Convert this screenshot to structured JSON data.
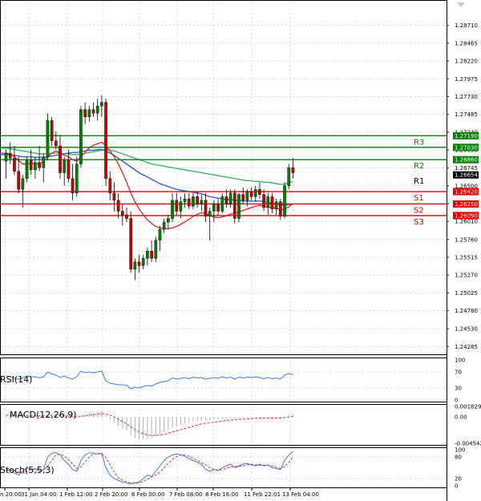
{
  "chart_data": {
    "type": "candlestick",
    "price_axis": {
      "ylim": [
        1.242,
        1.2895
      ],
      "ticks": [
        "1.28710",
        "1.28465",
        "1.28220",
        "1.27975",
        "1.27730",
        "1.27485",
        "1.27240",
        "1.26995",
        "1.26745",
        "1.26500",
        "1.26255",
        "1.26010",
        "1.25760",
        "1.25515",
        "1.25270",
        "1.25025",
        "1.24780",
        "1.24530",
        "1.24285"
      ]
    },
    "time_axis": {
      "labels": [
        "n 20:00",
        "31 Jan 04:00",
        "1 Feb 12:00",
        "2 Feb 20:00",
        "6 Feb 00:00",
        "7 Feb 08:00",
        "8 Feb 16:00",
        "11 Feb 22:01",
        "13 Feb 04:00"
      ]
    },
    "candles": [
      {
        "o": 1.2684,
        "h": 1.27,
        "l": 1.266,
        "c": 1.2695
      },
      {
        "o": 1.2695,
        "h": 1.271,
        "l": 1.268,
        "c": 1.2688
      },
      {
        "o": 1.2688,
        "h": 1.2705,
        "l": 1.2665,
        "c": 1.267
      },
      {
        "o": 1.267,
        "h": 1.269,
        "l": 1.264,
        "c": 1.2645
      },
      {
        "o": 1.2645,
        "h": 1.2665,
        "l": 1.262,
        "c": 1.266
      },
      {
        "o": 1.266,
        "h": 1.269,
        "l": 1.2655,
        "c": 1.2685
      },
      {
        "o": 1.2685,
        "h": 1.27,
        "l": 1.2665,
        "c": 1.2672
      },
      {
        "o": 1.2672,
        "h": 1.269,
        "l": 1.266,
        "c": 1.2682
      },
      {
        "o": 1.2682,
        "h": 1.2705,
        "l": 1.267,
        "c": 1.2675
      },
      {
        "o": 1.2675,
        "h": 1.2695,
        "l": 1.2655,
        "c": 1.269
      },
      {
        "o": 1.269,
        "h": 1.275,
        "l": 1.2685,
        "c": 1.274
      },
      {
        "o": 1.274,
        "h": 1.2745,
        "l": 1.2705,
        "c": 1.2712
      },
      {
        "o": 1.2712,
        "h": 1.2725,
        "l": 1.27,
        "c": 1.2705
      },
      {
        "o": 1.2705,
        "h": 1.272,
        "l": 1.266,
        "c": 1.2668
      },
      {
        "o": 1.2668,
        "h": 1.269,
        "l": 1.265,
        "c": 1.2685
      },
      {
        "o": 1.2685,
        "h": 1.27,
        "l": 1.2655,
        "c": 1.266
      },
      {
        "o": 1.266,
        "h": 1.268,
        "l": 1.263,
        "c": 1.264
      },
      {
        "o": 1.264,
        "h": 1.269,
        "l": 1.2635,
        "c": 1.268
      },
      {
        "o": 1.268,
        "h": 1.276,
        "l": 1.2675,
        "c": 1.2755
      },
      {
        "o": 1.2755,
        "h": 1.2765,
        "l": 1.2735,
        "c": 1.2745
      },
      {
        "o": 1.2745,
        "h": 1.276,
        "l": 1.2738,
        "c": 1.2755
      },
      {
        "o": 1.2755,
        "h": 1.2765,
        "l": 1.2745,
        "c": 1.275
      },
      {
        "o": 1.275,
        "h": 1.277,
        "l": 1.274,
        "c": 1.276
      },
      {
        "o": 1.276,
        "h": 1.2775,
        "l": 1.2745,
        "c": 1.2765
      },
      {
        "o": 1.2765,
        "h": 1.277,
        "l": 1.265,
        "c": 1.266
      },
      {
        "o": 1.266,
        "h": 1.267,
        "l": 1.263,
        "c": 1.264
      },
      {
        "o": 1.264,
        "h": 1.2655,
        "l": 1.2615,
        "c": 1.263
      },
      {
        "o": 1.263,
        "h": 1.264,
        "l": 1.2605,
        "c": 1.2615
      },
      {
        "o": 1.2615,
        "h": 1.2625,
        "l": 1.2595,
        "c": 1.261
      },
      {
        "o": 1.261,
        "h": 1.262,
        "l": 1.26,
        "c": 1.2605
      },
      {
        "o": 1.2605,
        "h": 1.2615,
        "l": 1.253,
        "c": 1.2535
      },
      {
        "o": 1.2535,
        "h": 1.255,
        "l": 1.252,
        "c": 1.2545
      },
      {
        "o": 1.2545,
        "h": 1.2555,
        "l": 1.253,
        "c": 1.254
      },
      {
        "o": 1.254,
        "h": 1.2555,
        "l": 1.2535,
        "c": 1.255
      },
      {
        "o": 1.255,
        "h": 1.2565,
        "l": 1.254,
        "c": 1.256
      },
      {
        "o": 1.256,
        "h": 1.2575,
        "l": 1.2545,
        "c": 1.255
      },
      {
        "o": 1.255,
        "h": 1.258,
        "l": 1.2545,
        "c": 1.2575
      },
      {
        "o": 1.2575,
        "h": 1.2595,
        "l": 1.256,
        "c": 1.259
      },
      {
        "o": 1.259,
        "h": 1.2605,
        "l": 1.2585,
        "c": 1.26
      },
      {
        "o": 1.26,
        "h": 1.261,
        "l": 1.259,
        "c": 1.2605
      },
      {
        "o": 1.2605,
        "h": 1.264,
        "l": 1.26,
        "c": 1.263
      },
      {
        "o": 1.263,
        "h": 1.264,
        "l": 1.261,
        "c": 1.2615
      },
      {
        "o": 1.2615,
        "h": 1.2635,
        "l": 1.2605,
        "c": 1.2628
      },
      {
        "o": 1.2628,
        "h": 1.264,
        "l": 1.262,
        "c": 1.2632
      },
      {
        "o": 1.2632,
        "h": 1.264,
        "l": 1.2618,
        "c": 1.2622
      },
      {
        "o": 1.2622,
        "h": 1.264,
        "l": 1.2618,
        "c": 1.2635
      },
      {
        "o": 1.2635,
        "h": 1.2642,
        "l": 1.262,
        "c": 1.2625
      },
      {
        "o": 1.2625,
        "h": 1.2638,
        "l": 1.2615,
        "c": 1.263
      },
      {
        "o": 1.263,
        "h": 1.264,
        "l": 1.26,
        "c": 1.2608
      },
      {
        "o": 1.2608,
        "h": 1.262,
        "l": 1.2575,
        "c": 1.2615
      },
      {
        "o": 1.2615,
        "h": 1.263,
        "l": 1.26,
        "c": 1.2625
      },
      {
        "o": 1.2625,
        "h": 1.2632,
        "l": 1.261,
        "c": 1.2615
      },
      {
        "o": 1.2615,
        "h": 1.264,
        "l": 1.2612,
        "c": 1.2635
      },
      {
        "o": 1.2635,
        "h": 1.2645,
        "l": 1.262,
        "c": 1.2625
      },
      {
        "o": 1.2625,
        "h": 1.2645,
        "l": 1.262,
        "c": 1.264
      },
      {
        "o": 1.264,
        "h": 1.2645,
        "l": 1.2598,
        "c": 1.2605
      },
      {
        "o": 1.2605,
        "h": 1.264,
        "l": 1.26,
        "c": 1.2638
      },
      {
        "o": 1.2638,
        "h": 1.2648,
        "l": 1.2625,
        "c": 1.263
      },
      {
        "o": 1.263,
        "h": 1.2645,
        "l": 1.2622,
        "c": 1.2642
      },
      {
        "o": 1.2642,
        "h": 1.2648,
        "l": 1.263,
        "c": 1.2635
      },
      {
        "o": 1.2635,
        "h": 1.265,
        "l": 1.2628,
        "c": 1.2645
      },
      {
        "o": 1.2645,
        "h": 1.2655,
        "l": 1.2632,
        "c": 1.2638
      },
      {
        "o": 1.2638,
        "h": 1.2645,
        "l": 1.2615,
        "c": 1.262
      },
      {
        "o": 1.262,
        "h": 1.264,
        "l": 1.261,
        "c": 1.2635
      },
      {
        "o": 1.2635,
        "h": 1.264,
        "l": 1.2612,
        "c": 1.2618
      },
      {
        "o": 1.2618,
        "h": 1.2632,
        "l": 1.261,
        "c": 1.2628
      },
      {
        "o": 1.2628,
        "h": 1.2632,
        "l": 1.2603,
        "c": 1.2608
      },
      {
        "o": 1.2608,
        "h": 1.2655,
        "l": 1.2605,
        "c": 1.265
      },
      {
        "o": 1.265,
        "h": 1.268,
        "l": 1.2645,
        "c": 1.2675
      },
      {
        "o": 1.2675,
        "h": 1.2688,
        "l": 1.266,
        "c": 1.2668
      }
    ],
    "moving_averages": [
      {
        "color": "#3cb371",
        "values": [
          1.2702,
          1.2701,
          1.27,
          1.2699,
          1.2698,
          1.2697,
          1.2696,
          1.2695,
          1.2694,
          1.2694,
          1.2694,
          1.2695,
          1.2695,
          1.2695,
          1.2694,
          1.2694,
          1.2693,
          1.2693,
          1.2694,
          1.2695,
          1.2696,
          1.2697,
          1.2698,
          1.2699,
          1.27,
          1.2699,
          1.2698,
          1.2696,
          1.2694,
          1.2692,
          1.269,
          1.2688,
          1.2686,
          1.2684,
          1.2682,
          1.268,
          1.2679,
          1.2678,
          1.2677,
          1.2676,
          1.2675,
          1.2674,
          1.2673,
          1.2672,
          1.2671,
          1.267,
          1.2669,
          1.2668,
          1.2667,
          1.2666,
          1.2665,
          1.2664,
          1.2663,
          1.2662,
          1.2661,
          1.266,
          1.2659,
          1.2658,
          1.2657,
          1.2657,
          1.2656,
          1.2656,
          1.2655,
          1.2655,
          1.2654,
          1.2653,
          1.2652,
          1.2652,
          1.2654,
          1.2656
        ]
      },
      {
        "color": "#3b5bcc",
        "values": [
          1.2693,
          1.2693,
          1.2692,
          1.2691,
          1.269,
          1.269,
          1.269,
          1.2689,
          1.2689,
          1.2689,
          1.269,
          1.2691,
          1.2692,
          1.2693,
          1.2694,
          1.2695,
          1.2696,
          1.2696,
          1.2697,
          1.2698,
          1.2699,
          1.2699,
          1.27,
          1.27,
          1.2698,
          1.2695,
          1.2692,
          1.2688,
          1.2684,
          1.268,
          1.2676,
          1.2672,
          1.2668,
          1.2665,
          1.2662,
          1.2659,
          1.2656,
          1.2653,
          1.2651,
          1.2649,
          1.2647,
          1.2645,
          1.2644,
          1.2643,
          1.2642,
          1.2641,
          1.264,
          1.2639,
          1.2637,
          1.2635,
          1.2634,
          1.2633,
          1.2632,
          1.2631,
          1.2631,
          1.263,
          1.263,
          1.2629,
          1.2629,
          1.2629,
          1.2629,
          1.2629,
          1.2628,
          1.2627,
          1.2626,
          1.2625,
          1.2624,
          1.2623,
          1.2624,
          1.2625
        ]
      },
      {
        "color": "#e03030",
        "values": [
          1.2695,
          1.2694,
          1.269,
          1.2685,
          1.268,
          1.268,
          1.2681,
          1.268,
          1.2681,
          1.2683,
          1.269,
          1.2695,
          1.2698,
          1.2695,
          1.2692,
          1.269,
          1.2686,
          1.2684,
          1.269,
          1.2696,
          1.2702,
          1.2706,
          1.2708,
          1.271,
          1.2705,
          1.2698,
          1.269,
          1.268,
          1.2668,
          1.2655,
          1.264,
          1.2628,
          1.2618,
          1.261,
          1.2603,
          1.2598,
          1.2594,
          1.2592,
          1.2591,
          1.2591,
          1.2592,
          1.2594,
          1.2597,
          1.26,
          1.2604,
          1.2608,
          1.2611,
          1.2613,
          1.2612,
          1.2609,
          1.2607,
          1.2606,
          1.2607,
          1.2609,
          1.2611,
          1.2612,
          1.2614,
          1.2616,
          1.2618,
          1.262,
          1.2622,
          1.2623,
          1.2622,
          1.2621,
          1.262,
          1.2619,
          1.2617,
          1.2618,
          1.2621,
          1.2625
        ]
      }
    ],
    "levels": [
      {
        "name": "R3",
        "value": 1.2719,
        "label": "1.27190",
        "color": "#008000"
      },
      {
        "name": "",
        "value": 1.2703,
        "label": "1.27030",
        "color": "#008000"
      },
      {
        "name": "R2",
        "value": 1.2686,
        "label": "1.26860",
        "color": "#008000"
      },
      {
        "name": "R1",
        "value": 1.2665,
        "label": "1.26654",
        "color": "#000000",
        "current": true
      },
      {
        "name": "S1",
        "value": 1.2642,
        "label": "1.26420",
        "color": "#e00000"
      },
      {
        "name": "S2",
        "value": 1.2625,
        "label": "1.26250",
        "color": "#e00000"
      },
      {
        "name": "S3",
        "value": 1.2609,
        "label": "1.26090",
        "color": "#e00000"
      }
    ],
    "rsi": {
      "label": "RSI(14)",
      "ticks": [
        "100",
        "70",
        "30",
        "0"
      ],
      "ylim": [
        0,
        100
      ],
      "values": [
        60,
        58,
        55,
        52,
        55,
        60,
        58,
        58,
        55,
        58,
        70,
        65,
        62,
        56,
        60,
        55,
        52,
        58,
        72,
        68,
        70,
        68,
        70,
        72,
        48,
        42,
        40,
        38,
        38,
        37,
        28,
        32,
        30,
        34,
        36,
        35,
        40,
        44,
        46,
        48,
        55,
        52,
        54,
        56,
        53,
        57,
        55,
        56,
        52,
        54,
        56,
        54,
        58,
        55,
        57,
        52,
        57,
        55,
        57,
        56,
        58,
        56,
        53,
        56,
        53,
        55,
        52,
        62,
        66,
        64
      ]
    },
    "macd": {
      "label": "MACD(12,26,9)",
      "ticks": [
        "0.001829",
        "0.00",
        "-0.004542"
      ],
      "ylim": [
        -0.004542,
        0.001829
      ],
      "hist": [
        0.0004,
        0.0004,
        0.0003,
        0.0002,
        0.0002,
        0.0002,
        0.0001,
        0.0001,
        0.0001,
        0.0001,
        0.0003,
        0.0004,
        0.0004,
        0.0002,
        0.0001,
        0.0,
        -0.0002,
        -0.0002,
        0.0003,
        0.0005,
        0.0007,
        0.0008,
        0.0009,
        0.001,
        0.0003,
        -0.0004,
        -0.001,
        -0.0016,
        -0.002,
        -0.0023,
        -0.0032,
        -0.0036,
        -0.0038,
        -0.0039,
        -0.0038,
        -0.0037,
        -0.0034,
        -0.003,
        -0.0026,
        -0.0022,
        -0.0018,
        -0.0016,
        -0.0013,
        -0.0011,
        -0.001,
        -0.0008,
        -0.0007,
        -0.0006,
        -0.0006,
        -0.0005,
        -0.0004,
        -0.0004,
        -0.0003,
        -0.0003,
        -0.0002,
        -0.0003,
        -0.0002,
        -0.0002,
        -0.0001,
        -0.0001,
        0.0,
        0.0,
        -0.0001,
        -0.0001,
        -0.0001,
        -0.0001,
        -0.0002,
        0.0001,
        0.0004,
        0.0005
      ],
      "signal": [
        0.0003,
        0.0003,
        0.0003,
        0.0003,
        0.0003,
        0.0003,
        0.0002,
        0.0002,
        0.0002,
        0.0002,
        0.0002,
        0.0003,
        0.0003,
        0.0003,
        0.0002,
        0.0002,
        0.0001,
        0.0,
        0.0001,
        0.0002,
        0.0003,
        0.0004,
        0.0005,
        0.0006,
        0.0005,
        0.0003,
        0.0,
        -0.0004,
        -0.0008,
        -0.0012,
        -0.0017,
        -0.0022,
        -0.0026,
        -0.0029,
        -0.0031,
        -0.0032,
        -0.0032,
        -0.0031,
        -0.003,
        -0.0028,
        -0.0026,
        -0.0024,
        -0.0022,
        -0.002,
        -0.0018,
        -0.0016,
        -0.0014,
        -0.0012,
        -0.0011,
        -0.001,
        -0.0009,
        -0.0008,
        -0.0007,
        -0.0006,
        -0.0005,
        -0.0005,
        -0.0004,
        -0.0004,
        -0.0003,
        -0.0003,
        -0.0002,
        -0.0002,
        -0.0002,
        -0.0002,
        -0.0002,
        -0.0002,
        -0.0002,
        -0.0001,
        0.0,
        0.0001
      ]
    },
    "stoch": {
      "label": "Stoch(5,5,3)",
      "ticks": [
        "100",
        "80",
        "20",
        "0"
      ],
      "ylim": [
        0,
        100
      ],
      "k": [
        40,
        45,
        35,
        30,
        40,
        50,
        45,
        48,
        40,
        45,
        80,
        90,
        92,
        85,
        70,
        60,
        45,
        40,
        70,
        85,
        92,
        90,
        88,
        90,
        50,
        30,
        20,
        15,
        10,
        8,
        5,
        8,
        10,
        20,
        30,
        25,
        40,
        55,
        70,
        80,
        85,
        88,
        86,
        82,
        75,
        70,
        65,
        60,
        45,
        40,
        45,
        42,
        50,
        55,
        60,
        50,
        55,
        60,
        62,
        58,
        55,
        60,
        55,
        58,
        50,
        48,
        45,
        70,
        85,
        95
      ],
      "d": [
        45,
        44,
        42,
        38,
        35,
        40,
        45,
        47,
        45,
        43,
        55,
        70,
        85,
        88,
        82,
        72,
        60,
        48,
        52,
        65,
        80,
        88,
        90,
        89,
        78,
        58,
        38,
        22,
        15,
        11,
        8,
        7,
        8,
        12,
        18,
        25,
        30,
        38,
        50,
        62,
        73,
        81,
        85,
        85,
        82,
        76,
        70,
        65,
        58,
        50,
        45,
        43,
        45,
        48,
        52,
        54,
        54,
        55,
        58,
        60,
        58,
        57,
        57,
        57,
        55,
        51,
        48,
        53,
        65,
        80
      ]
    }
  }
}
